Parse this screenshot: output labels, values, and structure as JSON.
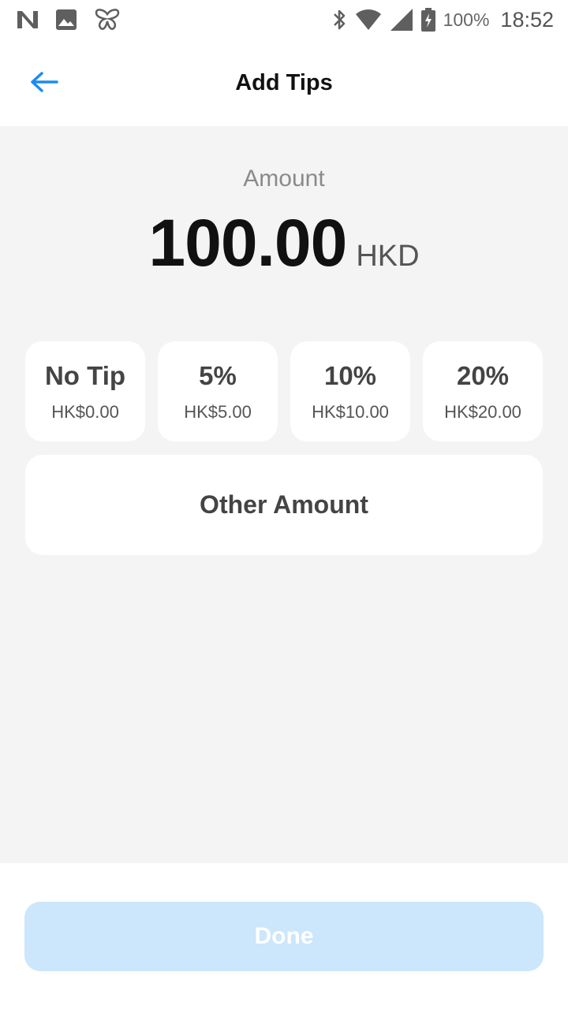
{
  "status_bar": {
    "icons_left": [
      "n-icon",
      "image-icon",
      "butterfly-icon"
    ],
    "icons_right": [
      "bluetooth-icon",
      "wifi-icon",
      "signal-icon",
      "battery-icon"
    ],
    "battery": "100%",
    "time": "18:52"
  },
  "header": {
    "title": "Add Tips",
    "back_icon": "arrow-left-icon"
  },
  "amount": {
    "label": "Amount",
    "value": "100.00",
    "currency": "HKD"
  },
  "tip_options": [
    {
      "name": "No Tip",
      "amount": "HK$0.00"
    },
    {
      "name": "5%",
      "amount": "HK$5.00"
    },
    {
      "name": "10%",
      "amount": "HK$10.00"
    },
    {
      "name": "20%",
      "amount": "HK$20.00"
    }
  ],
  "other_amount": {
    "label": "Other Amount"
  },
  "footer": {
    "done_label": "Done"
  },
  "colors": {
    "accent": "#1a8cf0",
    "done_button_disabled": "#cce6fb",
    "content_background": "#f4f4f4"
  }
}
